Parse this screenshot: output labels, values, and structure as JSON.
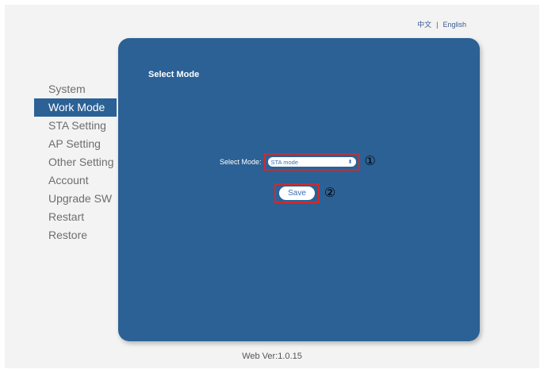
{
  "header": {
    "lang_cn": "中文",
    "lang_separator": "|",
    "lang_en": "English"
  },
  "sidebar": {
    "items": [
      {
        "label": "System"
      },
      {
        "label": "Work Mode"
      },
      {
        "label": "STA Setting"
      },
      {
        "label": "AP Setting"
      },
      {
        "label": "Other Setting"
      },
      {
        "label": "Account"
      },
      {
        "label": "Upgrade SW"
      },
      {
        "label": "Restart"
      },
      {
        "label": "Restore"
      }
    ],
    "active_index": 1
  },
  "panel": {
    "title": "Select Mode",
    "select_label": "Select Mode:",
    "select_value": "STA mode",
    "marker_select": "①",
    "save_label": "Save",
    "marker_save": "②"
  },
  "footer": {
    "version": "Web Ver:1.0.15"
  },
  "colors": {
    "panel_bg": "#2b6195",
    "active_item_bg": "#2b6195",
    "highlight_border": "#d12a2a",
    "link": "#3a5a90"
  },
  "icons": {
    "select_chevron": "chevron-up-down-icon"
  }
}
